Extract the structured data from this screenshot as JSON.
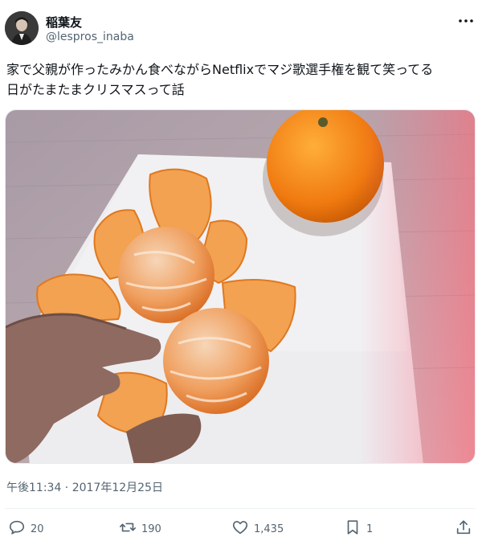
{
  "author": {
    "name": "稲葉友",
    "handle": "@lespros_inaba"
  },
  "tweet": {
    "text": "家で父親が作ったみかん食べながらNetflixでマジ歌選手権を観て笑ってる\n日がたまたまクリスマスって話",
    "timestamp": "午後11:34 · 2017年12月25日"
  },
  "actions": {
    "reply_count": "20",
    "retweet_count": "190",
    "like_count": "1,435",
    "bookmark_count": "1"
  },
  "icons": {
    "more": "more-dots-icon",
    "reply": "reply-icon",
    "retweet": "retweet-icon",
    "like": "heart-icon",
    "bookmark": "bookmark-icon",
    "share": "share-icon"
  },
  "colors": {
    "text": "#0f1419",
    "secondary": "#536471",
    "divider": "#eff3f4"
  }
}
